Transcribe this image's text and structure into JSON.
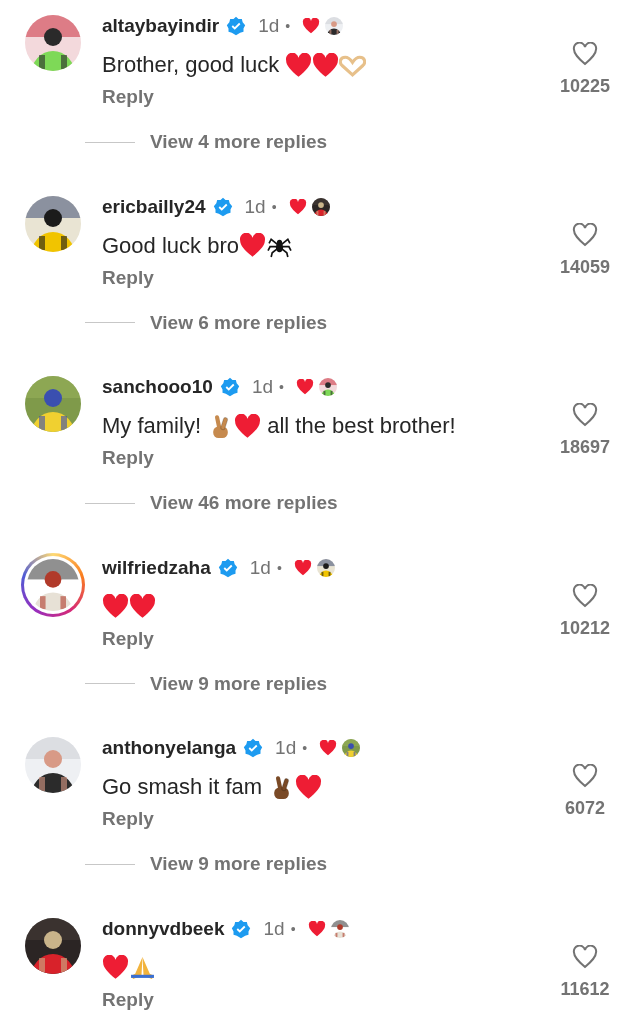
{
  "comments": [
    {
      "username": "altaybayindir",
      "verified": true,
      "time": "1d",
      "separator": "•",
      "liked_by_author": true,
      "story": false,
      "body": [
        {
          "kind": "text",
          "text": "Brother, good luck "
        },
        {
          "kind": "heart"
        },
        {
          "kind": "heart"
        },
        {
          "kind": "heart-hands",
          "color": "#e7c08a"
        }
      ],
      "reply": "Reply",
      "liked": false,
      "likes": "10225",
      "more_replies": "View 4 more replies"
    },
    {
      "username": "ericbailly24",
      "verified": true,
      "time": "1d",
      "separator": "•",
      "liked_by_author": true,
      "story": false,
      "body": [
        {
          "kind": "text",
          "text": "Good luck bro"
        },
        {
          "kind": "heart"
        },
        {
          "kind": "spider"
        }
      ],
      "reply": "Reply",
      "liked": false,
      "likes": "14059",
      "more_replies": "View 6 more replies"
    },
    {
      "username": "sanchooo10",
      "verified": true,
      "time": "1d",
      "separator": "•",
      "liked_by_author": true,
      "story": false,
      "body": [
        {
          "kind": "text",
          "text": "My family! "
        },
        {
          "kind": "crossed-fingers",
          "color": "#c68a4e"
        },
        {
          "kind": "heart"
        },
        {
          "kind": "text",
          "text": " all the best brother!"
        }
      ],
      "reply": "Reply",
      "liked": false,
      "likes": "18697",
      "more_replies": "View 46 more replies"
    },
    {
      "username": "wilfriedzaha",
      "verified": true,
      "time": "1d",
      "separator": "•",
      "liked_by_author": true,
      "story": true,
      "body": [
        {
          "kind": "heart"
        },
        {
          "kind": "heart"
        }
      ],
      "reply": "Reply",
      "liked": false,
      "likes": "10212",
      "more_replies": "View 9 more replies"
    },
    {
      "username": "anthonyelanga",
      "verified": true,
      "time": "1d",
      "separator": "•",
      "liked_by_author": true,
      "story": false,
      "body": [
        {
          "kind": "text",
          "text": "Go smash it fam "
        },
        {
          "kind": "crossed-fingers",
          "color": "#7a4a26"
        },
        {
          "kind": "heart"
        }
      ],
      "reply": "Reply",
      "liked": false,
      "likes": "6072",
      "more_replies": "View 9 more replies"
    },
    {
      "username": "donnyvdbeek",
      "verified": true,
      "time": "1d",
      "separator": "•",
      "liked_by_author": true,
      "story": false,
      "body": [
        {
          "kind": "heart"
        },
        {
          "kind": "praying-hands",
          "color": "#f2b33d"
        }
      ],
      "reply": "Reply",
      "liked": false,
      "likes": "11612"
    }
  ]
}
